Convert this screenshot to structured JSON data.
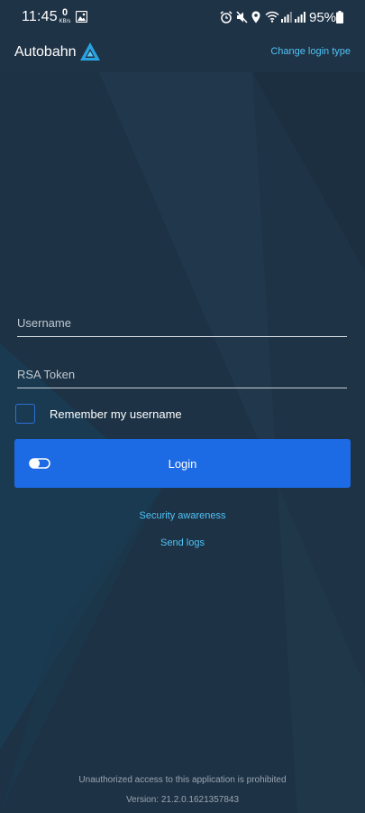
{
  "status_bar": {
    "time": "11:45",
    "data_rate_value": "0",
    "data_rate_unit": "KB/s",
    "battery_percent": "95%",
    "icons": [
      "image-icon",
      "alarm-icon",
      "mute-icon",
      "location-icon",
      "wifi-icon",
      "signal-icon",
      "signal-icon",
      "battery-icon"
    ]
  },
  "header": {
    "app_title": "Autobahn",
    "change_login_label": "Change login type"
  },
  "form": {
    "username_placeholder": "Username",
    "username_value": "",
    "rsa_placeholder": "RSA Token",
    "rsa_value": "",
    "remember_label": "Remember my username",
    "remember_checked": false,
    "login_label": "Login"
  },
  "links": {
    "security_awareness": "Security awareness",
    "send_logs": "Send logs"
  },
  "footer": {
    "warning": "Unauthorized access to this application is prohibited",
    "version": "Version: 21.2.0.1621357843"
  },
  "colors": {
    "background": "#1f3346",
    "accent": "#1d6ae5",
    "link": "#4fc3f7"
  }
}
